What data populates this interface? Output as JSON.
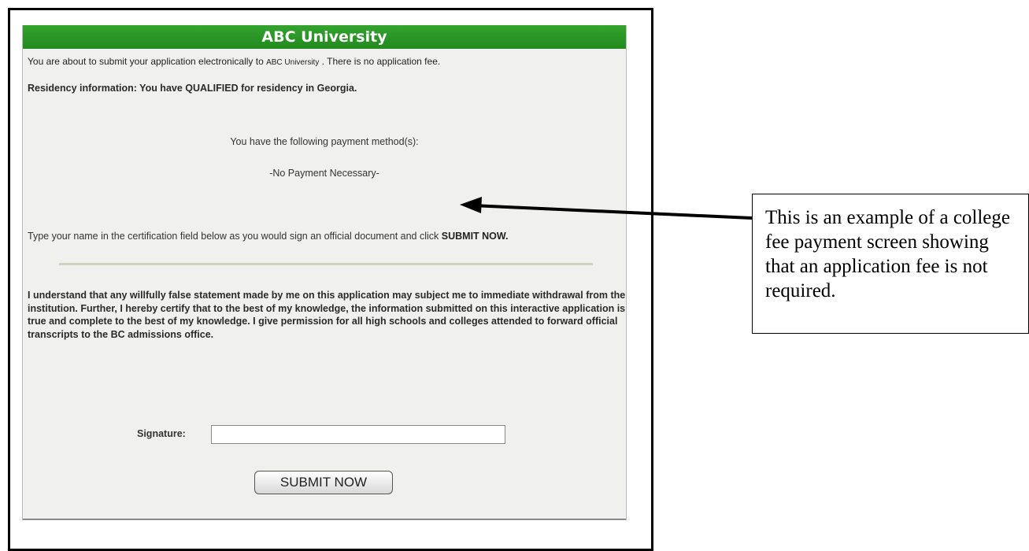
{
  "header": {
    "title": "ABC University"
  },
  "intro": {
    "prefix": "You are about to submit your application electronically to ",
    "university": "ABC University",
    "suffix": "   . There is no application fee."
  },
  "residency": "Residency information: You have QUALIFIED for residency in Georgia.",
  "payment": {
    "heading": "You have the following payment method(s):",
    "method": "-No Payment Necessary-"
  },
  "instruction": {
    "text": "Type your name in the certification field below as you would sign an official document and click ",
    "action": "SUBMIT NOW."
  },
  "certification": "I understand that any willfully false statement made by me on this application may subject me to immediate withdrawal from the institution. Further, I hereby certify that to the best of my knowledge, the information submitted on this interactive application is true and complete to the best of my knowledge. I give permission for all high schools and colleges attended to forward official transcripts to the BC admissions office.",
  "signature": {
    "label": "Signature:",
    "value": ""
  },
  "submit_button": {
    "label": "SUBMIT NOW"
  },
  "annotation": {
    "text": "This is an example of a college fee payment screen showing that an application fee is not required."
  },
  "colors": {
    "header_green": "#2a9625",
    "panel_bg": "#f0f0ee"
  }
}
